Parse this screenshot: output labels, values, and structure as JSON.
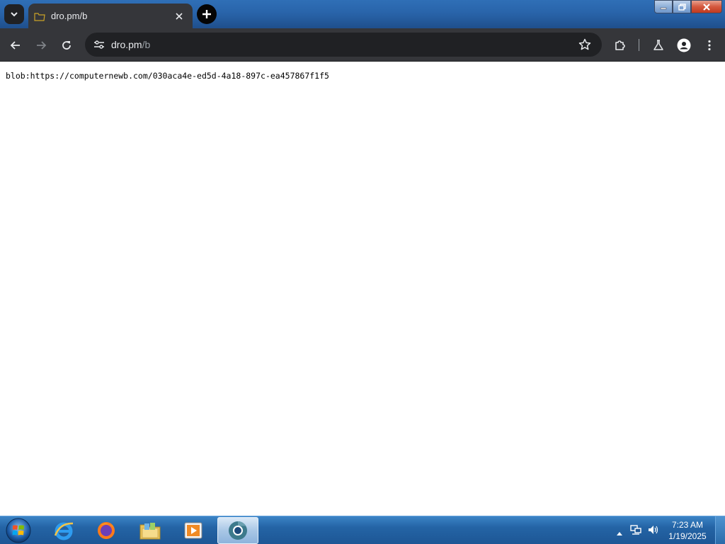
{
  "browser": {
    "tab": {
      "title": "dro.pm/b"
    },
    "url": {
      "host": "dro.pm",
      "path": "/b"
    }
  },
  "page": {
    "text": "blob:https://computernewb.com/030aca4e-ed5d-4a18-897c-ea457867f1f5"
  },
  "taskbar": {
    "apps": [
      {
        "name": "internet-explorer"
      },
      {
        "name": "firefox"
      },
      {
        "name": "file-explorer"
      },
      {
        "name": "media-player"
      },
      {
        "name": "chrome",
        "active": true
      }
    ],
    "clock": {
      "time": "7:23 AM",
      "date": "1/19/2025"
    }
  },
  "colors": {
    "toolbar": "#35363a",
    "omnibox": "#202124",
    "taskbar": "#2464a5"
  }
}
